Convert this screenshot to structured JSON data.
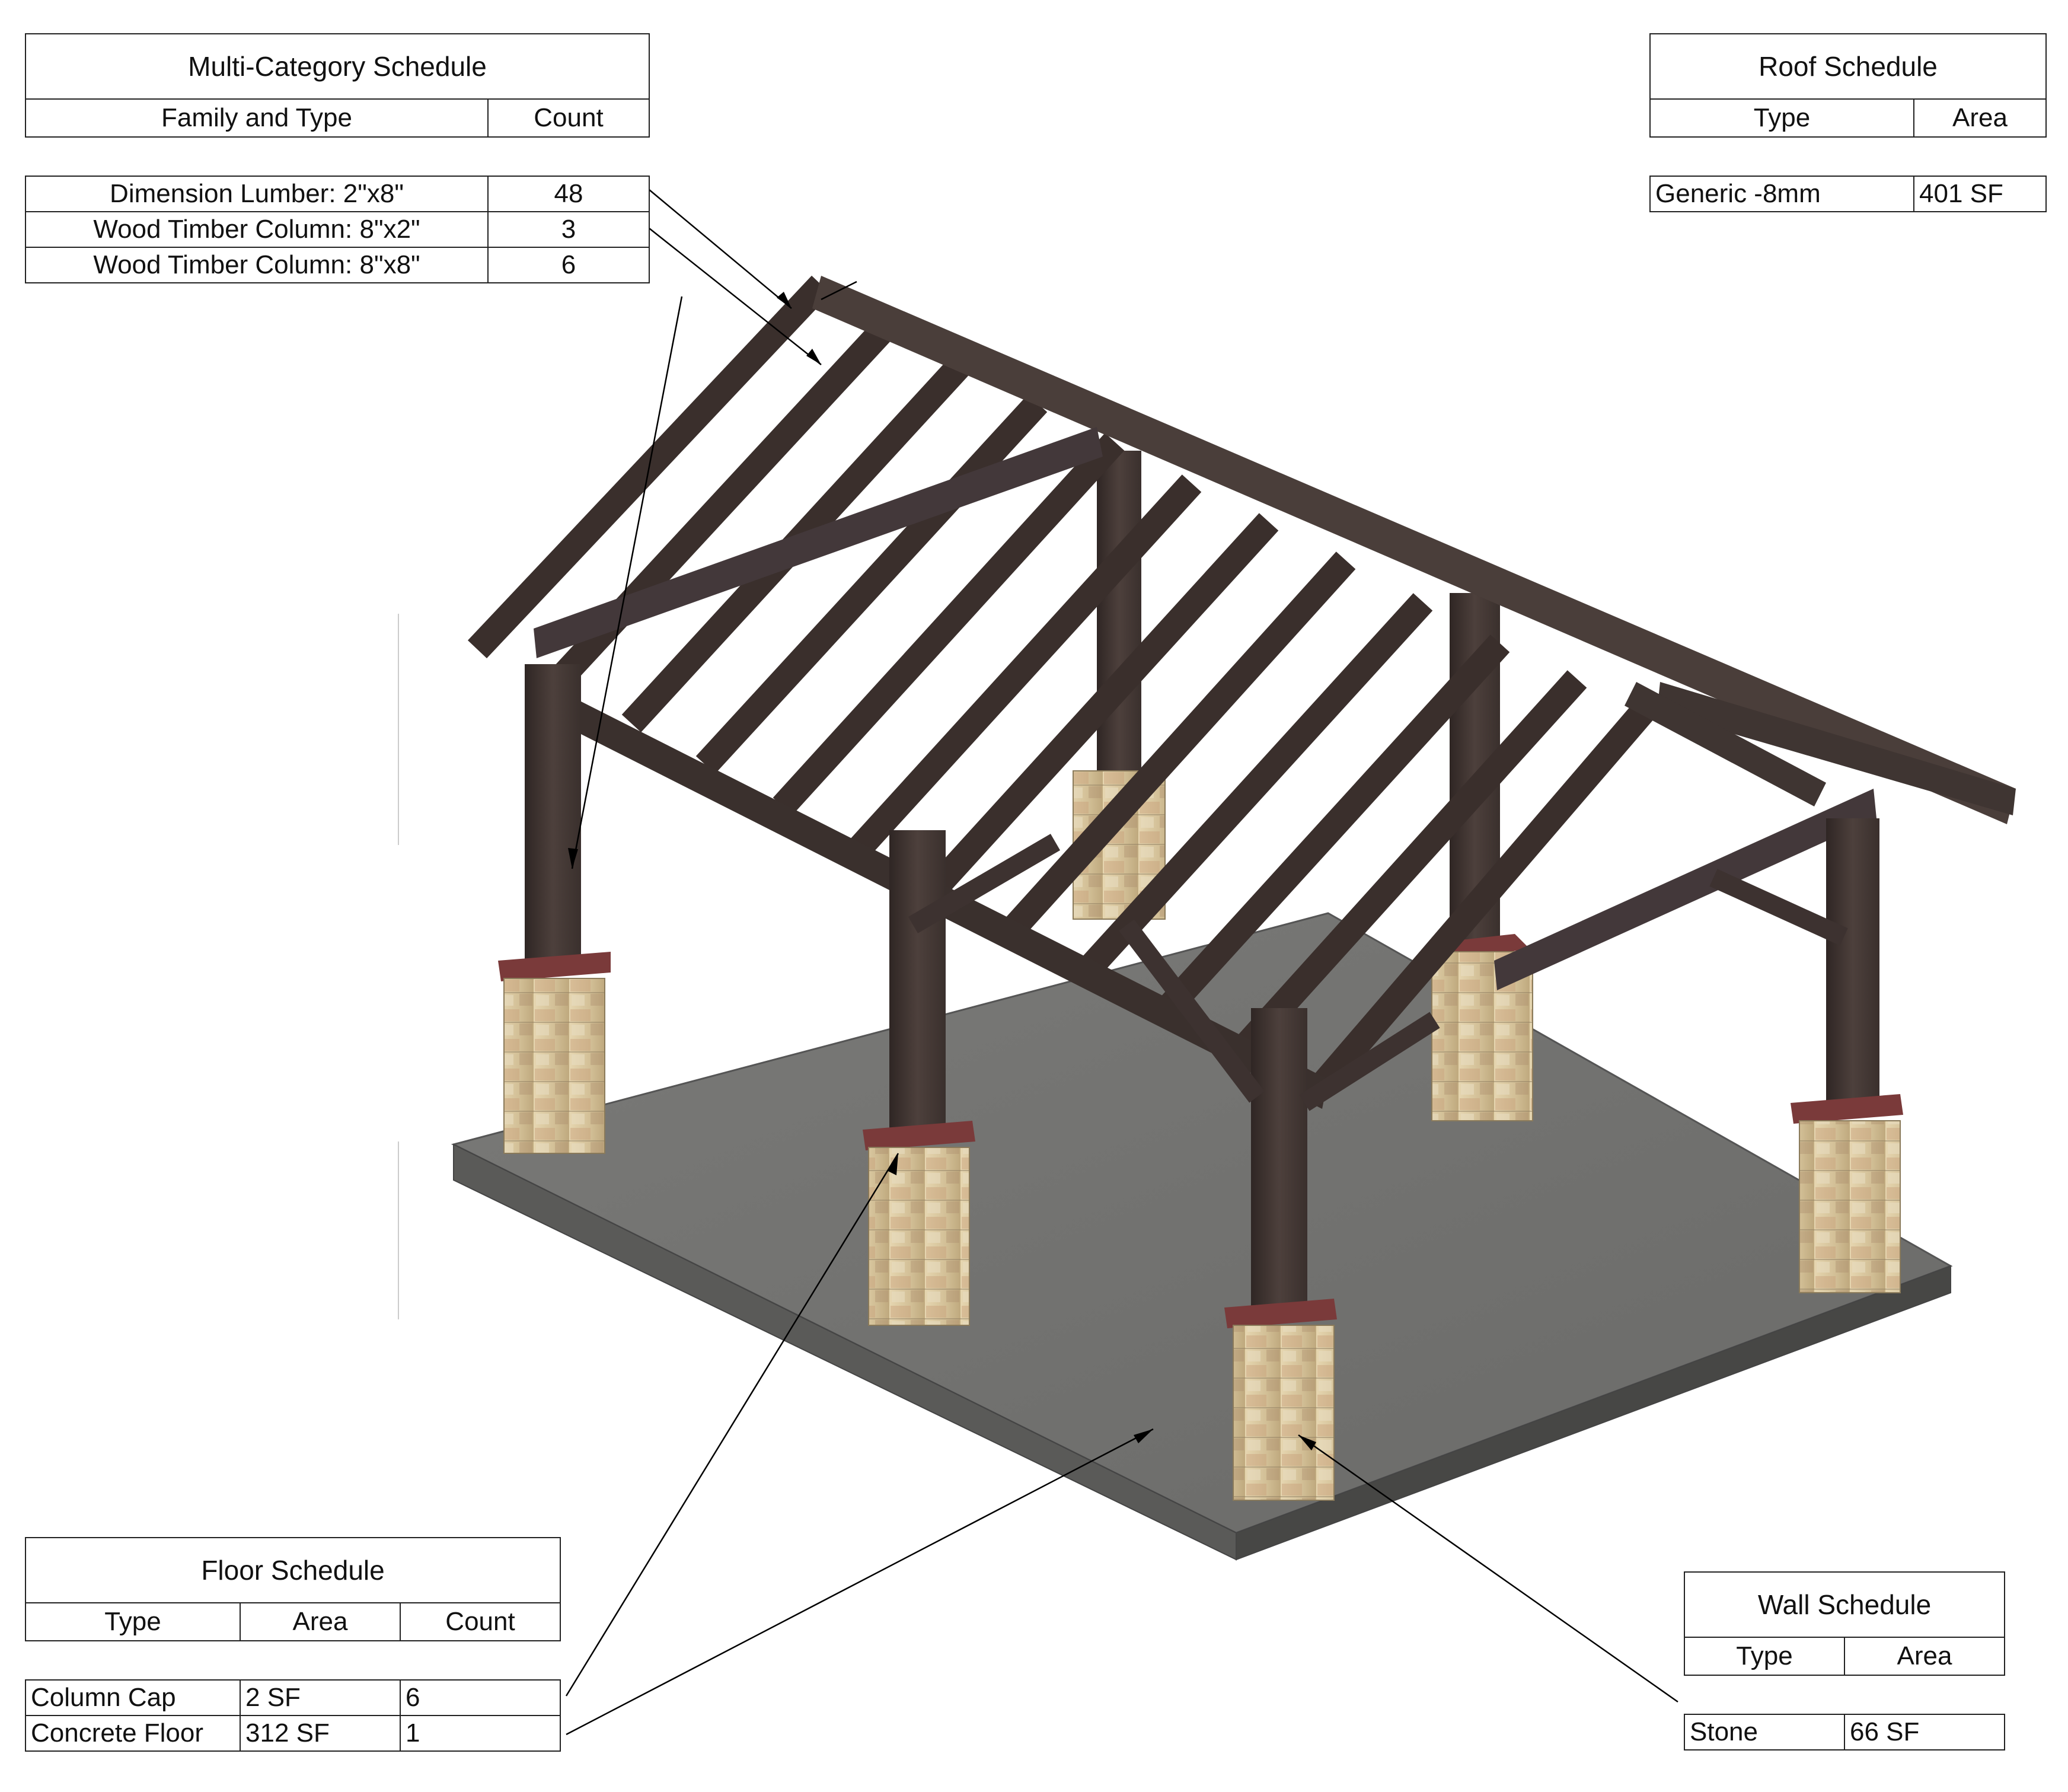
{
  "multi_category_schedule": {
    "title": "Multi-Category Schedule",
    "columns": [
      "Family and Type",
      "Count"
    ],
    "rows": [
      {
        "family_and_type": "Dimension Lumber: 2\"x8\"",
        "count": "48"
      },
      {
        "family_and_type": "Wood Timber Column: 8\"x2\"",
        "count": "3"
      },
      {
        "family_and_type": "Wood Timber Column: 8\"x8\"",
        "count": "6"
      }
    ]
  },
  "roof_schedule": {
    "title": "Roof Schedule",
    "columns": [
      "Type",
      "Area"
    ],
    "rows": [
      {
        "type": "Generic -8mm",
        "area": "401 SF"
      }
    ]
  },
  "floor_schedule": {
    "title": "Floor Schedule",
    "columns": [
      "Type",
      "Area",
      "Count"
    ],
    "rows": [
      {
        "type": "Column Cap",
        "area": "2 SF",
        "count": "6"
      },
      {
        "type": "Concrete Floor",
        "area": "312 SF",
        "count": "1"
      }
    ]
  },
  "wall_schedule": {
    "title": "Wall Schedule",
    "columns": [
      "Type",
      "Area"
    ],
    "rows": [
      {
        "type": "Stone",
        "area": "66 SF"
      }
    ]
  },
  "colors": {
    "timber": "#3f3532",
    "timber_light": "#5b4d48",
    "slab_top": "#727270",
    "slab_edge": "#4e4e4c",
    "stone": "#d8c6a0",
    "column_cap": "#7a3a3a",
    "leader_line": "#000000"
  }
}
